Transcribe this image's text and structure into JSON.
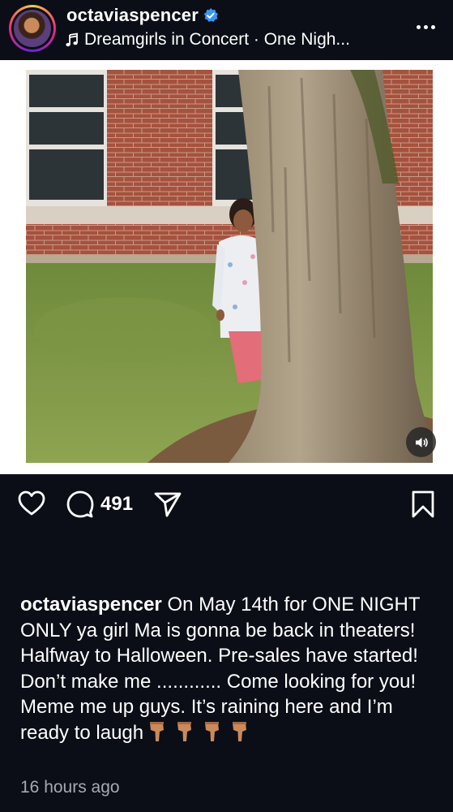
{
  "post": {
    "username": "octaviaspencer",
    "verified": true,
    "audio_title": "Dreamgirls in Concert · One Nigh...",
    "image_description_icon": "photo-of-woman-peeking-from-behind-tree"
  },
  "actions": {
    "comment_count": "491"
  },
  "caption": {
    "username": "octaviaspencer",
    "text": "On May 14th for ONE NIGHT ONLY ya girl Ma is gonna be back in theaters! Halfway to Halloween. Pre-sales have started!  Don’t make me ............ Come looking for you! Meme me up guys. It’s raining here and I’m ready to laugh"
  },
  "timestamp": "16 hours ago",
  "colors": {
    "background": "#0b0e17",
    "verified_badge": "#3897f0",
    "secondary_text": "#a8a8b0",
    "pointer_emoji": "#c98a5c"
  },
  "icons": [
    "verified-icon",
    "music-note-icon",
    "more-options-icon",
    "heart-icon",
    "comment-icon",
    "share-icon",
    "bookmark-icon",
    "volume-icon",
    "pointing-down-emoji"
  ]
}
